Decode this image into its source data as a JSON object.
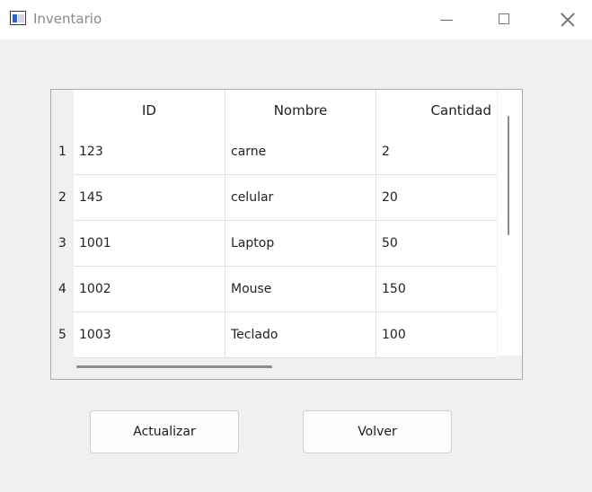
{
  "window": {
    "title": "Inventario",
    "icons": {
      "app": "app-icon",
      "minimize": "minimize-icon",
      "maximize": "maximize-icon",
      "close": "close-icon"
    }
  },
  "table": {
    "columns": [
      "ID",
      "Nombre",
      "Cantidad"
    ],
    "row_numbers": [
      "1",
      "2",
      "3",
      "4",
      "5"
    ],
    "rows": [
      [
        "123",
        "carne",
        "2"
      ],
      [
        "145",
        "celular",
        "20"
      ],
      [
        "1001",
        "Laptop",
        "50"
      ],
      [
        "1002",
        "Mouse",
        "150"
      ],
      [
        "1003",
        "Teclado",
        "100"
      ]
    ]
  },
  "buttons": {
    "update": "Actualizar",
    "back": "Volver"
  }
}
